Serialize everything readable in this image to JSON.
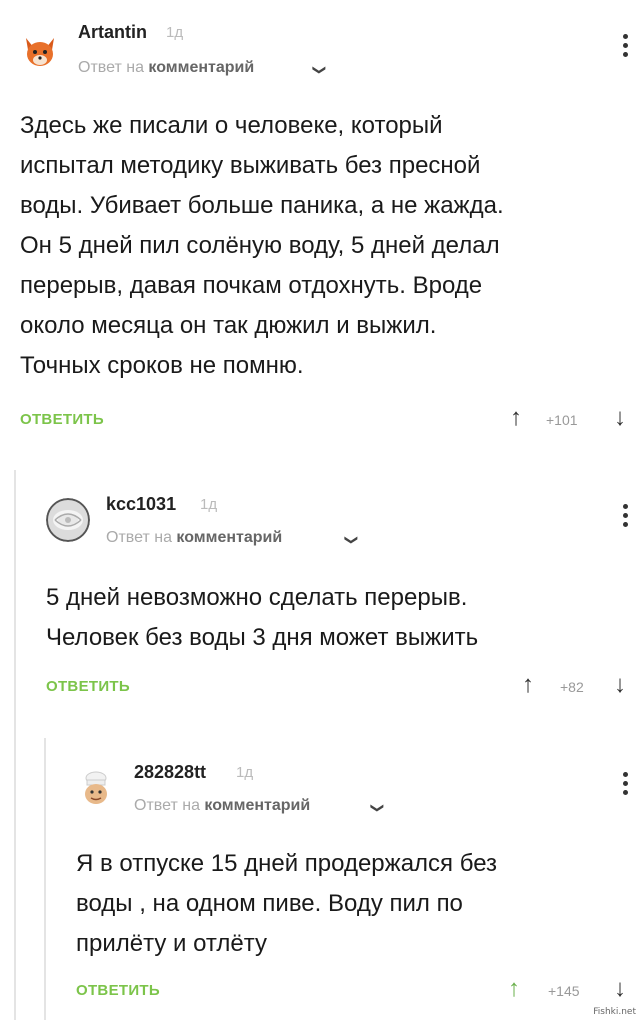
{
  "comments": [
    {
      "username": "Artantin",
      "time": "1д",
      "reply_prefix": "Ответ на",
      "reply_target": "комментарий",
      "text": "Здесь же писали о человеке, который\nиспытал методику выживать без пресной\nводы. Убивает больше паника, а не жажда.\nОн 5 дней пил солёную воду, 5 дней делал\nперерыв, давая почкам отдохнуть. Вроде\nоколо месяца он так дюжил и выжил.\nТочных сроков не помню.",
      "reply_label": "ОТВЕТИТЬ",
      "score": "+101"
    },
    {
      "username": "kcc1031",
      "time": "1д",
      "reply_prefix": "Ответ на",
      "reply_target": "комментарий",
      "text": "5 дней невозможно сделать перерыв.\nЧеловек без воды 3 дня может выжить",
      "reply_label": "ОТВЕТИТЬ",
      "score": "+82"
    },
    {
      "username": "282828tt",
      "time": "1д",
      "reply_prefix": "Ответ на",
      "reply_target": "комментарий",
      "text": "Я в отпуске 15 дней продержался без\nводы , на одном пиве. Воду пил по\nприлёту и отлёту",
      "reply_label": "ОТВЕТИТЬ",
      "score": "+145"
    }
  ],
  "icons": {
    "up": "arrow-up-icon",
    "down": "arrow-down-icon",
    "chevron": "chevron-down-icon",
    "menu": "more-vertical-icon"
  },
  "colors": {
    "reply": "#7cc44a",
    "upvoted": "#6ab04c",
    "thread_line": "#e4e4e4"
  },
  "watermark": "Fishki.net"
}
